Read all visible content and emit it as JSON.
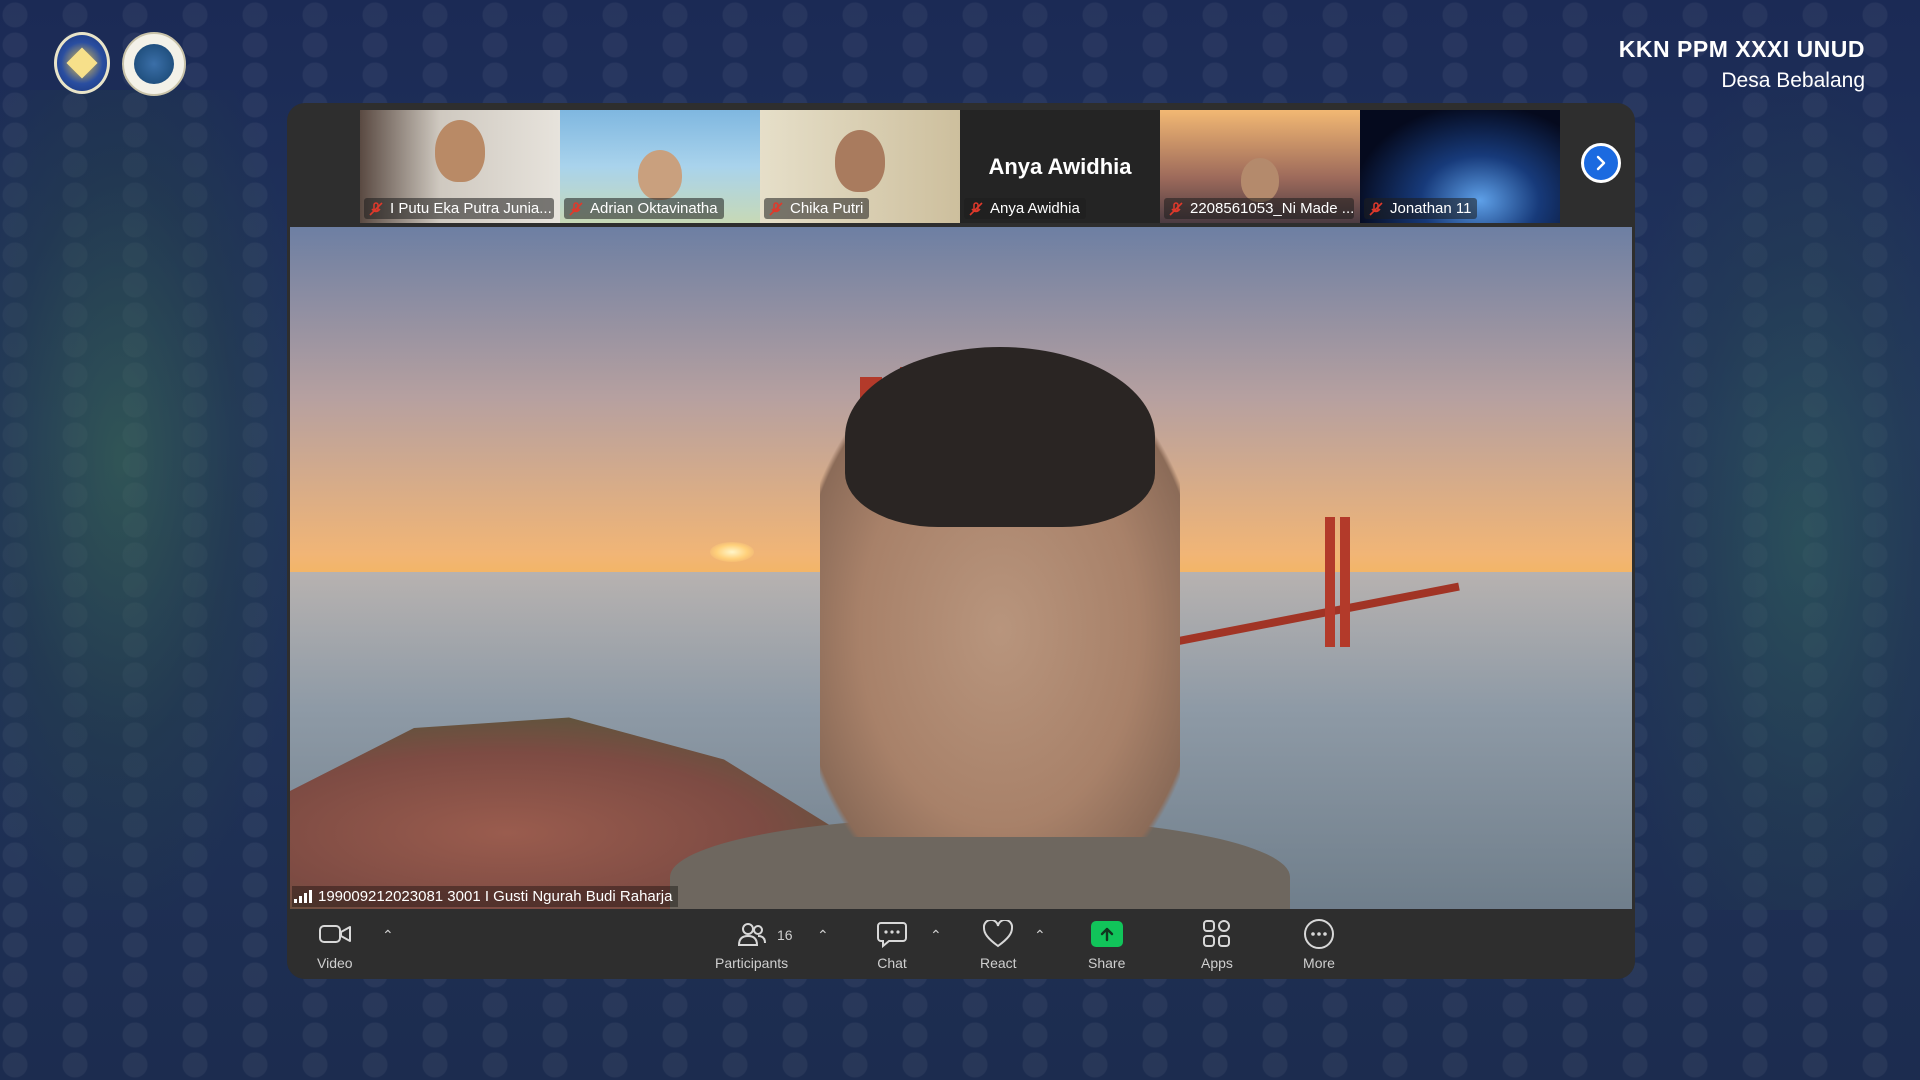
{
  "header": {
    "title": "KKN PPM XXXI UNUD",
    "subtitle": "Desa Bebalang"
  },
  "participants_strip": [
    {
      "name": "I Putu Eka Putra Junia...",
      "muted": true
    },
    {
      "name": "Adrian Oktavinatha",
      "muted": true
    },
    {
      "name": "Chika Putri",
      "muted": true
    },
    {
      "name": "Anya Awidhia",
      "display_name": "Anya Awidhia",
      "muted": true
    },
    {
      "name": "2208561053_Ni Made ...",
      "muted": true
    },
    {
      "name": "Jonathan 11",
      "muted": true
    }
  ],
  "speaker": {
    "name": "199009212023081 3001 I Gusti Ngurah Budi Raharja"
  },
  "toolbar": {
    "video_label": "Video",
    "participants_label": "Participants",
    "participants_count": "16",
    "chat_label": "Chat",
    "react_label": "React",
    "share_label": "Share",
    "apps_label": "Apps",
    "more_label": "More"
  },
  "colors": {
    "share_green": "#11c45a",
    "mute_red": "#e0392b",
    "next_blue": "#1b6ae0",
    "toolbar_bg": "#2e2e2e"
  }
}
